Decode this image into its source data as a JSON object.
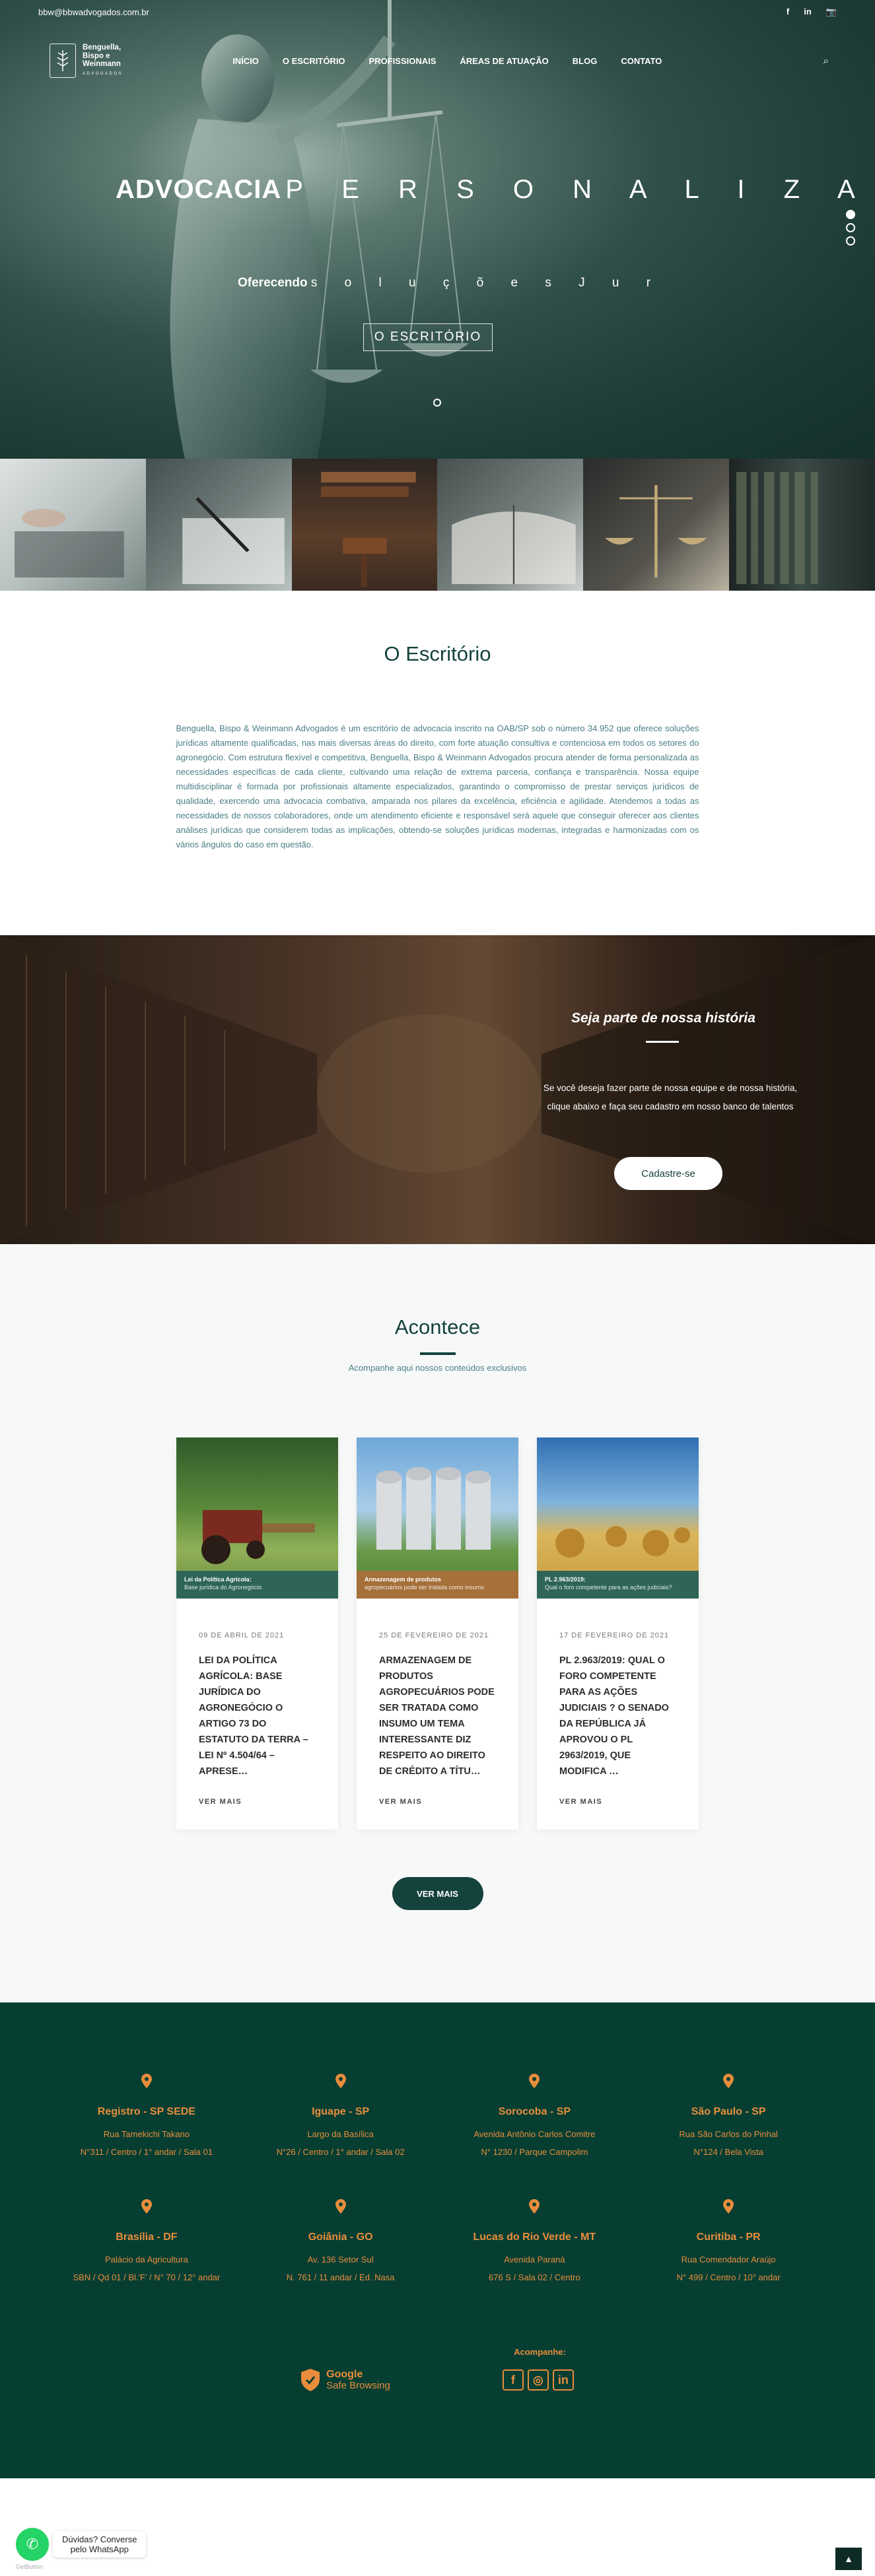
{
  "topbar": {
    "email": "bbw@bbwadvogados.com.br",
    "social": [
      "f",
      "in",
      "📷"
    ]
  },
  "logo": {
    "line1": "Benguella,",
    "line2": "Bispo e",
    "line3": "Weinmann",
    "sub": "ADVOGADOS"
  },
  "nav": {
    "items": [
      "INÍCIO",
      "O ESCRITÓRIO",
      "PROFISSIONAIS",
      "ÁREAS DE ATUAÇÃO",
      "BLOG",
      "CONTATO"
    ]
  },
  "hero": {
    "title_bold": "ADVOCACIA",
    "title_spread": "P E R S O N A L I Z A",
    "sub_bold": "Oferecendo",
    "sub_spread": "s o l u ç õ e s J u r",
    "button": "O ESCRITÓRIO"
  },
  "escritorio": {
    "title": "O Escritório",
    "text": "Benguella, Bispo & Weinmann Advogados é um escritório de advocacia inscrito na OAB/SP sob o número 34.952 que oferece soluções jurídicas altamente qualificadas, nas mais diversas áreas do direito, com forte atuação consultiva e contenciosa em todos os setores do agronegócio. Com estrutura flexível e competitiva, Benguella, Bispo & Weinmann Advogados procura atender de forma personalizada as necessidades específicas de cada cliente, cultivando uma relação de extrema parceria, confiança e transparência. Nossa equipe multidisciplinar é formada por profissionais altamente especializados, garantindo o compromisso de prestar serviços jurídicos de qualidade, exercendo uma advocacia combativa, amparada nos pilares da excelência, eficiência e agilidade. Atendemos a todas as necessidades de nossos colaboradores, onde um atendimento eficiente e responsável será aquele que conseguir oferecer aos clientes análises jurídicas que considerem todas as implicações, obtendo-se soluções jurídicas modernas, integradas e harmonizadas com os vários ângulos do caso em questão."
  },
  "join": {
    "title": "Seja parte de nossa história",
    "text": "Se você deseja fazer parte de nossa equipe e de nossa história, clique abaixo e faça seu cadastro em nosso banco de talentos",
    "button": "Cadastre-se"
  },
  "acontece": {
    "title": "Acontece",
    "subtitle": "Acompanhe aqui nossos conteúdos exclusivos",
    "cards": [
      {
        "band1": "Lei da Política Agrícola:",
        "band2": "Base jurídica do Agronegócio",
        "date": "09 DE ABRIL DE 2021",
        "title": "LEI DA POLÍTICA AGRÍCOLA: BASE JURÍDICA DO AGRONEGÓCIO O ARTIGO 73 DO ESTATUTO DA TERRA – LEI Nº 4.504/64 – APRESE…",
        "more": "VER MAIS"
      },
      {
        "band1": "Armazenagem de produtos",
        "band2": "agropecuários pode ser tratada como insumo",
        "date": "25 DE FEVEREIRO DE 2021",
        "title": "ARMAZENAGEM DE PRODUTOS AGROPECUÁRIOS PODE SER TRATADA COMO INSUMO UM TEMA INTERESSANTE DIZ RESPEITO AO DIREITO DE CRÉDITO A TÍTU…",
        "more": "VER MAIS"
      },
      {
        "band1": "PL 2.963/2019:",
        "band2": "Qual o foro competente para as ações judiciais?",
        "date": "17 DE FEVEREIRO DE 2021",
        "title": "PL 2.963/2019: QUAL O FORO COMPETENTE PARA AS AÇÕES JUDICIAIS ? O SENADO DA REPÚBLICA JÁ APROVOU O PL 2963/2019, QUE MODIFICA …",
        "more": "VER MAIS"
      }
    ],
    "button": "VER MAIS"
  },
  "footer": {
    "offices": [
      {
        "name": "Registro - SP SEDE",
        "l1": "Rua Tamekichi Takano",
        "l2": "N°311 / Centro / 1° andar / Sala 01"
      },
      {
        "name": "Iguape - SP",
        "l1": "Largo da Basílica",
        "l2": "N°26 / Centro / 1° andar / Sala 02"
      },
      {
        "name": "Sorocoba - SP",
        "l1": "Avenida Antônio Carlos Comitre",
        "l2": "N° 1230 / Parque Campolim"
      },
      {
        "name": "São Paulo - SP",
        "l1": "Rua São Carlos do Pinhal",
        "l2": "N°124 / Bela Vista"
      },
      {
        "name": "Brasília - DF",
        "l1": "Palácio da Agricultura",
        "l2": "SBN / Qd 01 / Bl.'F' / N° 70 / 12° andar"
      },
      {
        "name": "Goiânia - GO",
        "l1": "Av. 136 Setor Sul",
        "l2": "N. 761 / 11 andar / Ed. Nasa"
      },
      {
        "name": "Lucas do Rio Verde - MT",
        "l1": "Avenida Paraná",
        "l2": "676 S / Sala 02 / Centro"
      },
      {
        "name": "Curitiba - PR",
        "l1": "Rua Comendador Araújo",
        "l2": "N° 499 / Centro / 10° andar"
      }
    ],
    "acompanhe": "Acompanhe:",
    "gsafe1": "Google",
    "gsafe2": "Safe Browsing",
    "social": [
      "f",
      "◎",
      "in"
    ]
  },
  "whatsapp": {
    "line1": "Dúvidas? Converse",
    "line2": "pelo WhatsApp",
    "tag": "GetButton"
  }
}
